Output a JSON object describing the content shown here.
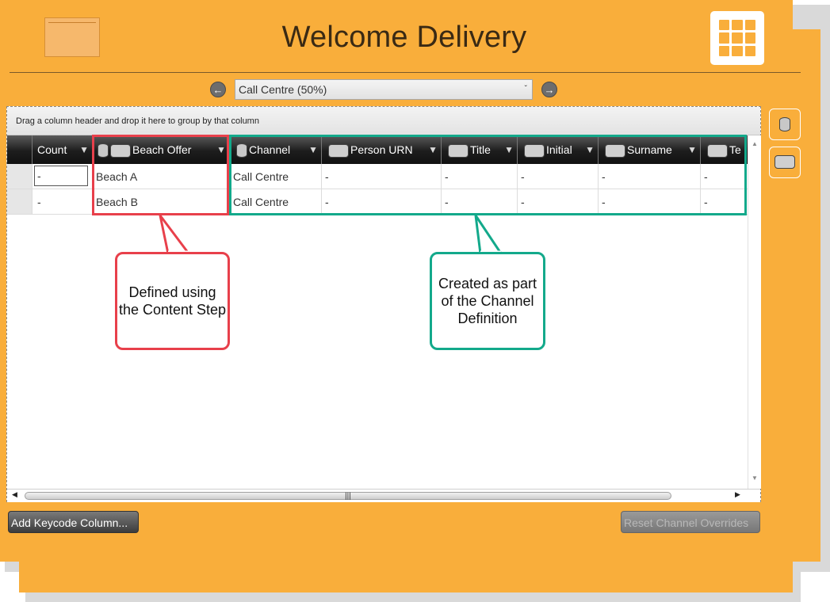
{
  "header": {
    "title": "Welcome Delivery",
    "left_icon": "folder-icon",
    "right_icon": "app-grid-icon"
  },
  "channel_nav": {
    "prev_icon": "arrow-left-icon",
    "next_icon": "arrow-right-icon",
    "selected": "Call Centre (50%)"
  },
  "grid": {
    "group_hint": "Drag a column header and drop it here to group by that column",
    "columns": [
      {
        "label": "Count",
        "icons": []
      },
      {
        "label": "Beach Offer",
        "icons": [
          "database-icon",
          "keycode-icon"
        ]
      },
      {
        "label": "Channel",
        "icons": [
          "database-icon"
        ]
      },
      {
        "label": "Person URN",
        "icons": [
          "keycode-icon"
        ]
      },
      {
        "label": "Title",
        "icons": [
          "keycode-icon"
        ]
      },
      {
        "label": "Initial",
        "icons": [
          "keycode-icon"
        ]
      },
      {
        "label": "Surname",
        "icons": [
          "keycode-icon"
        ]
      },
      {
        "label": "Te",
        "icons": [
          "keycode-icon"
        ]
      }
    ],
    "rows": [
      {
        "count": "-",
        "beach_offer": "Beach A",
        "channel": "Call Centre",
        "person_urn": "-",
        "title": "-",
        "initial": "-",
        "surname": "-",
        "te": "-"
      },
      {
        "count": "-",
        "beach_offer": "Beach B",
        "channel": "Call Centre",
        "person_urn": "-",
        "title": "-",
        "initial": "-",
        "surname": "-",
        "te": "-"
      }
    ]
  },
  "side_tools": [
    {
      "icon": "database-icon"
    },
    {
      "icon": "keycode-icon"
    }
  ],
  "buttons": {
    "add_keycode": "Add Keycode Column...",
    "reset_overrides": "Reset Channel Overrides"
  },
  "callouts": {
    "content_step": "Defined using the Content Step",
    "channel_definition": "Created as part of the Channel Definition"
  },
  "colors": {
    "background": "#f9ae3b",
    "highlight_red": "#e8404b",
    "highlight_green": "#13a98b"
  }
}
